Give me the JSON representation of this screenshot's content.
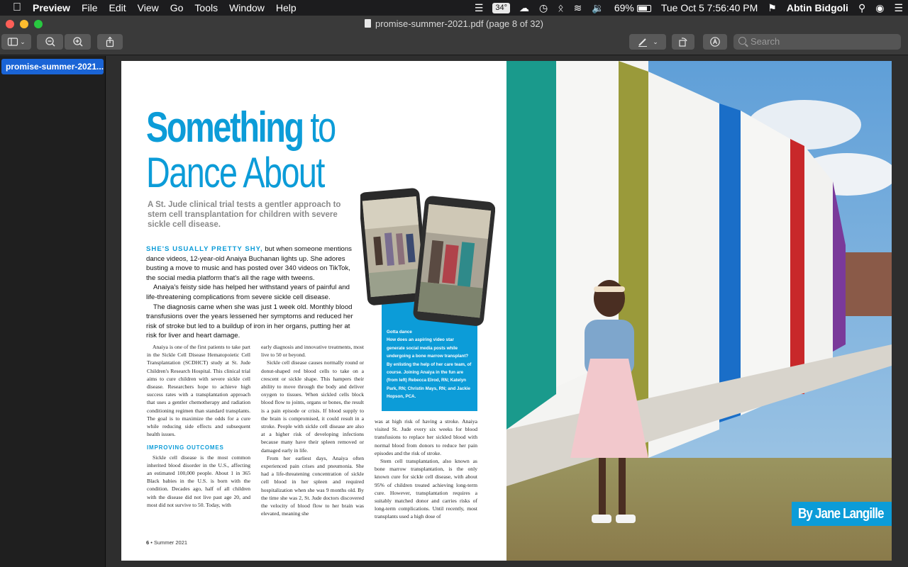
{
  "menubar": {
    "app_name": "Preview",
    "menus": [
      "File",
      "Edit",
      "View",
      "Go",
      "Tools",
      "Window",
      "Help"
    ],
    "temperature": "34°",
    "battery": "69%",
    "datetime": "Tue Oct 5  7:56:40 PM",
    "user": "Abtin Bidgoli"
  },
  "window": {
    "title": "promise-summer-2021.pdf (page 8 of 32)",
    "search_placeholder": "Search"
  },
  "sidebar": {
    "items": [
      {
        "label": "promise-summer-2021..."
      }
    ]
  },
  "article": {
    "title_bold": "Something",
    "title_thin": " to",
    "title_line2": "Dance About",
    "deck": "A St. Jude clinical trial tests a gentler approach to stem cell transplantation for children with severe sickle cell disease.",
    "lead_in": "SHE'S USUALLY PRETTY SHY,",
    "intro_p1": " but when someone mentions dance videos, 12-year-old Anaiya Buchanan lights up. She adores busting a move to music and has posted over 340 videos on TikTok, the social media platform that's all the rage with tweens.",
    "intro_p2": "Anaiya's feisty side has helped her withstand years of painful and life-threatening complications from severe sickle cell disease.",
    "intro_p3": "The diagnosis came when she was just 1 week old. Monthly blood transfusions over the years lessened her symptoms and reduced her risk of stroke but led to a buildup of iron in her organs, putting her at risk for liver and heart damage.",
    "col1_p1": "Anaiya is one of the first patients to take part in the Sickle Cell Disease Hematopoietic Cell Transplantation (SCDHCT) study at St. Jude Children's Research Hospital. This clinical trial aims to cure children with severe sickle cell disease. Researchers hope to achieve high success rates with a transplantation approach that uses a gentler chemotherapy and radiation conditioning regimen than standard transplants. The goal is to maximize the odds for a cure while reducing side effects and subsequent health issues.",
    "col1_sub": "IMPROVING OUTCOMES",
    "col1_p2": "Sickle cell disease is the most common inherited blood disorder in the U.S., affecting an estimated 100,000 people. About 1 in 365 Black babies in the U.S. is born with the condition. Decades ago, half of all children with the disease did not live past age 20, and most did not survive to 50. Today, with",
    "col2_p1": "early diagnosis and innovative treatments, most live to 50 or beyond.",
    "col2_p2": "Sickle cell disease causes normally round or donut-shaped red blood cells to take on a crescent or sickle shape. This hampers their ability to move through the body and deliver oxygen to tissues. When sickled cells block blood flow to joints, organs or bones, the result is a pain episode or crisis. If blood supply to the brain is compromised, it could result in a stroke. People with sickle cell disease are also at a higher risk of developing infections because many have their spleen removed or damaged early in life.",
    "col2_p3": "From her earliest days, Anaiya often experienced pain crises and pneumonia. She had a life-threatening concentration of sickle cell blood in her spleen and required hospitalization when she was 9 months old. By the time she was 2, St. Jude doctors discovered the velocity of blood flow to her brain was elevated, meaning she",
    "col3_p1": "was at high risk of having a stroke. Anaiya visited St. Jude every six weeks for blood transfusions to replace her sickled blood with normal blood from donors to reduce her pain episodes and the risk of stroke.",
    "col3_p2": "Stem cell transplantation, also known as bone marrow transplantation, is the only known cure for sickle cell disease, with about 95% of children treated achieving long-term cure. However, transplantation requires a suitably matched donor and carries risks of long-term complications. Until recently, most transplants used a high dose of",
    "caption_title": "Gotta dance",
    "caption_text": "How does an aspiring video star generate social media posts while undergoing a bone marrow transplant? By enlisting the help of her care team, of course. Joining Anaiya in the fun are (from left) Rebecca Elrod, RN; Katelyn Park, RN; Christin Mays, RN; and Jackie Hopson, PCA.",
    "folio_num": "6",
    "folio_text": " • Summer 2021",
    "byline": "By Jane Langille"
  },
  "colors": {
    "accent": "#0c9cd8",
    "selection": "#1a64d6",
    "menubar": "#1c1c1e",
    "toolbar": "#3a3a3a"
  }
}
